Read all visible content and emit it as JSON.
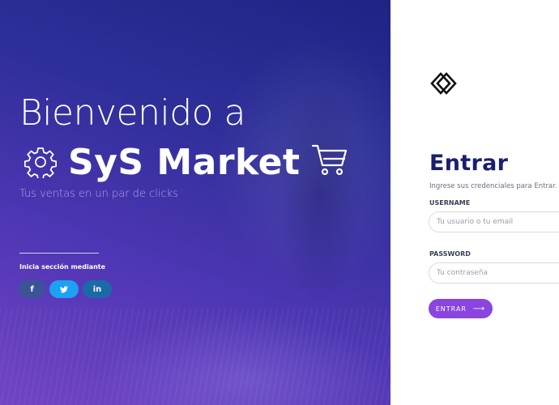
{
  "hero": {
    "title": "Bienvenido a",
    "brand": "SyS Market",
    "tagline": "Tus ventas en un par de clicks",
    "social_label": "Inicia sección mediante",
    "social": [
      {
        "name": "facebook",
        "glyph": "f",
        "icon": "facebook-icon",
        "color": "#3b5498"
      },
      {
        "name": "twitter",
        "glyph": "🐦",
        "icon": "twitter-icon",
        "color": "#1da1f2"
      },
      {
        "name": "linkedin",
        "glyph": "in",
        "icon": "linkedin-icon",
        "color": "#1a6aa8"
      }
    ],
    "icons": {
      "gear": "gear-icon",
      "cart": "cart-icon"
    },
    "gradient_colors": [
      "#1f2384",
      "#4e36b4",
      "#7244c6"
    ]
  },
  "login": {
    "logo_icon": "diamond-logo-icon",
    "title": "Entrar",
    "subtitle": "Ingrese sus credenciales para Entrar.",
    "username_label": "USERNAME",
    "username_placeholder": "Tu usuario o tu email",
    "username_value": "",
    "password_label": "PASSWORD",
    "password_placeholder": "Tu contraseña",
    "password_value": "",
    "submit_label": "ENTRAR",
    "submit_icon": "arrow-right-icon",
    "accent_color": "#8a45e0",
    "title_color": "#1a1f6e"
  }
}
